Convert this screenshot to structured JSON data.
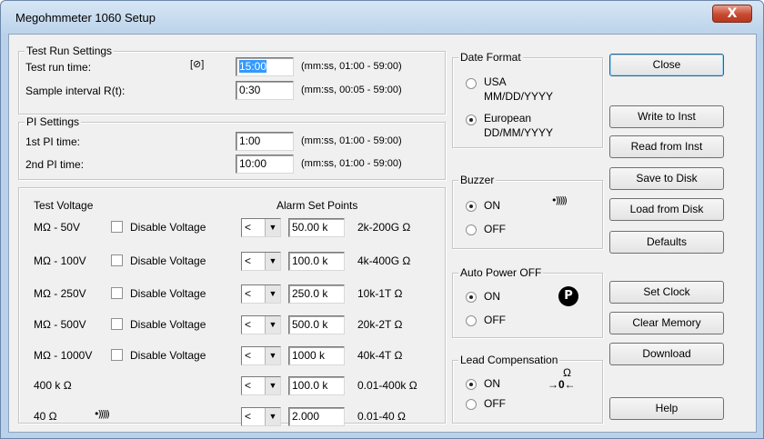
{
  "window": {
    "title": "Megohmmeter 1060 Setup",
    "close_glyph": "X"
  },
  "test_run": {
    "group_label": "Test Run Settings",
    "run_time_label": "Test run time:",
    "clock_icon": "clock-icon",
    "clock_glyph": "[⊘]",
    "run_time_value": "15:00",
    "run_time_range": "(mm:ss, 01:00 - 59:00)",
    "sample_label": "Sample interval R(t):",
    "sample_value": "0:30",
    "sample_range": "(mm:ss, 00:05 - 59:00)"
  },
  "pi": {
    "group_label": "PI Settings",
    "first_label": "1st PI time:",
    "first_value": "1:00",
    "first_range": "(mm:ss, 01:00 - 59:00)",
    "second_label": "2nd PI time:",
    "second_value": "10:00",
    "second_range": "(mm:ss, 01:00 - 59:00)"
  },
  "voltage": {
    "header_left": "Test Voltage",
    "header_right": "Alarm Set Points",
    "disable_label": "Disable Voltage",
    "rows": [
      {
        "name": "MΩ - 50V",
        "has_checkbox": true,
        "op": "<",
        "value": "50.00 k",
        "range": "2k-200G Ω"
      },
      {
        "name": "MΩ - 100V",
        "has_checkbox": true,
        "op": "<",
        "value": "100.0 k",
        "range": "4k-400G Ω"
      },
      {
        "name": "MΩ - 250V",
        "has_checkbox": true,
        "op": "<",
        "value": "250.0 k",
        "range": "10k-1T Ω"
      },
      {
        "name": "MΩ - 500V",
        "has_checkbox": true,
        "op": "<",
        "value": "500.0 k",
        "range": "20k-2T Ω"
      },
      {
        "name": "MΩ - 1000V",
        "has_checkbox": true,
        "op": "<",
        "value": "1000 k",
        "range": "40k-4T Ω"
      },
      {
        "name": "400 k Ω",
        "has_checkbox": false,
        "op": "<",
        "value": "100.0 k",
        "range": "0.01-400k Ω"
      },
      {
        "name": "40 Ω",
        "has_checkbox": false,
        "op": "<",
        "value": "2.000",
        "range": "0.01-40 Ω"
      }
    ],
    "sound_glyph": "•)))))"
  },
  "date_format": {
    "group_label": "Date Format",
    "usa_label": "USA",
    "usa_format": "MM/DD/YYYY",
    "european_label": "European",
    "european_format": "DD/MM/YYYY",
    "selected": "European"
  },
  "buzzer": {
    "group_label": "Buzzer",
    "on": "ON",
    "off": "OFF",
    "selected": "ON",
    "icon_glyph": "•)))))"
  },
  "auto_power": {
    "group_label": "Auto Power OFF",
    "on": "ON",
    "off": "OFF",
    "selected": "ON",
    "icon_glyph": "P"
  },
  "lead_comp": {
    "group_label": "Lead Compensation",
    "on": "ON",
    "off": "OFF",
    "selected": "ON",
    "icon_top": "Ω",
    "icon_bottom": "→0←"
  },
  "buttons": {
    "close": "Close",
    "write": "Write to Inst",
    "read": "Read from Inst",
    "save": "Save to Disk",
    "load": "Load from Disk",
    "defaults": "Defaults",
    "set_clock": "Set Clock",
    "clear_memory": "Clear Memory",
    "download": "Download",
    "help": "Help"
  }
}
